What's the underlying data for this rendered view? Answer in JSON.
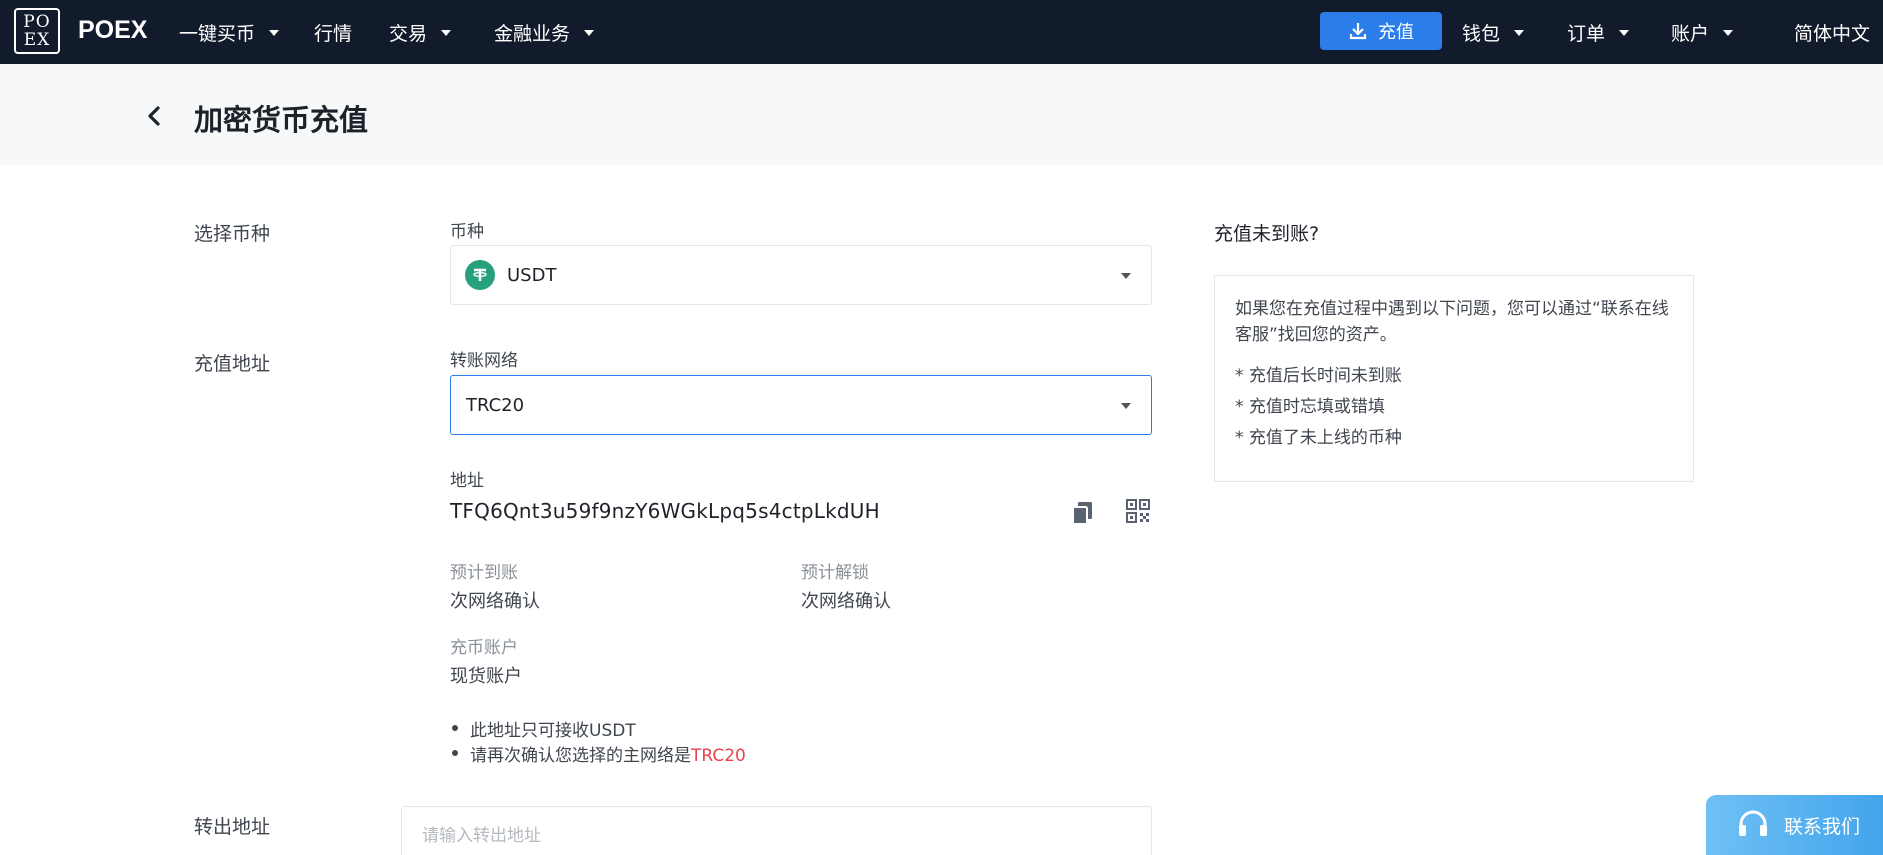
{
  "nav": {
    "logo_line1": "PO",
    "logo_line2": "EX",
    "brand": "POEX",
    "items": [
      {
        "label": "一键买币"
      },
      {
        "label": "行情"
      },
      {
        "label": "交易"
      },
      {
        "label": "金融业务"
      }
    ],
    "deposit_button": "充值",
    "right_items": [
      {
        "label": "钱包"
      },
      {
        "label": "订单"
      },
      {
        "label": "账户"
      }
    ],
    "language": "简体中文"
  },
  "page": {
    "title": "加密货币充值"
  },
  "form": {
    "select_coin_section": "选择币种",
    "coin_label": "币种",
    "coin_value": "USDT",
    "deposit_address_section": "充值地址",
    "network_label": "转账网络",
    "network_value": "TRC20",
    "address_label": "地址",
    "address_value": "TFQ6Qnt3u59f9nzY6WGkLpq5s4ctpLkdUH",
    "expected_arrival_label": "预计到账",
    "expected_arrival_value": "次网络确认",
    "expected_unlock_label": "预计解锁",
    "expected_unlock_value": "次网络确认",
    "deposit_account_label": "充币账户",
    "deposit_account_value": "现货账户",
    "note1": "此地址只可接收USDT",
    "note2_prefix": "请再次确认您选择的主网络是",
    "note2_network": "TRC20",
    "withdraw_section": "转出地址",
    "withdraw_placeholder": "请输入转出地址"
  },
  "help": {
    "title": "充值未到账?",
    "description": "如果您在充值过程中遇到以下问题，您可以通过“联系在线客服”找回您的资产。",
    "items": [
      "* 充值后长时间未到账",
      "* 充值时忘填或错填",
      "* 充值了未上线的币种"
    ]
  },
  "contact": {
    "label": "联系我们"
  },
  "colors": {
    "nav_bg": "#121b2b",
    "accent": "#2b7de9",
    "tether": "#26a17b",
    "warn": "#e8434b"
  }
}
